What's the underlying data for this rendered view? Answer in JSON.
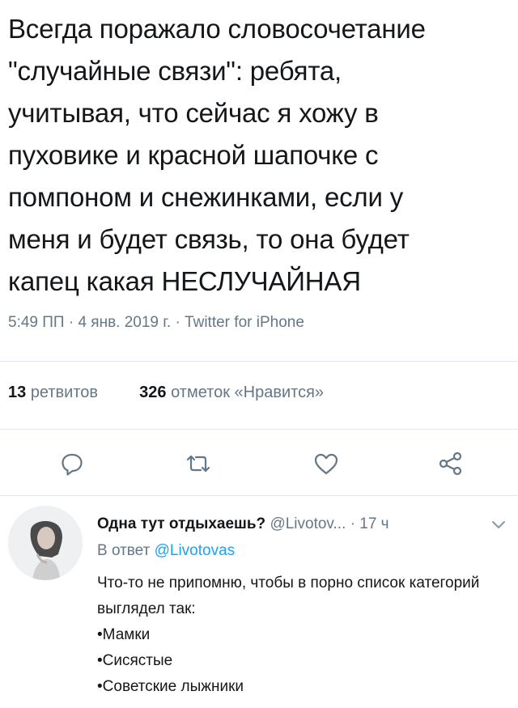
{
  "tweet": {
    "text": "Всегда поражало словосочетание\n\"случайные связи\": ребята,\nучитывая, что сейчас я хожу в\nпуховике и красной шапочке с\nпомпоном и снежинками, если у\nменя и будет связь, то она будет\nкапец какая НЕСЛУЧАЙНАЯ",
    "meta": "5:49 ПП · 4 янв. 2019 г. · Twitter for iPhone"
  },
  "stats": {
    "retweets_count": "13",
    "retweets_label": "ретвитов",
    "likes_count": "326",
    "likes_label": "отметок «Нравится»"
  },
  "actions": [
    {
      "icon": "reply-icon"
    },
    {
      "icon": "retweet-icon"
    },
    {
      "icon": "like-icon"
    },
    {
      "icon": "share-icon"
    }
  ],
  "reply": {
    "name": "Одна тут отдыхаешь?",
    "handle": "@Livotov...",
    "separator": "·",
    "time": "17 ч",
    "in_reply_prefix": "В ответ",
    "in_reply_handle": "@Livotovas",
    "text_intro": "Что-то не припомню, чтобы в порно список категорий выглядел так:",
    "items": [
      "•Мамки",
      "•Сисястые",
      "•Советские лыжники"
    ]
  },
  "colors": {
    "text": "#14171a",
    "muted": "#657786",
    "link": "#1da1f2",
    "divider": "#e1e8ed"
  }
}
